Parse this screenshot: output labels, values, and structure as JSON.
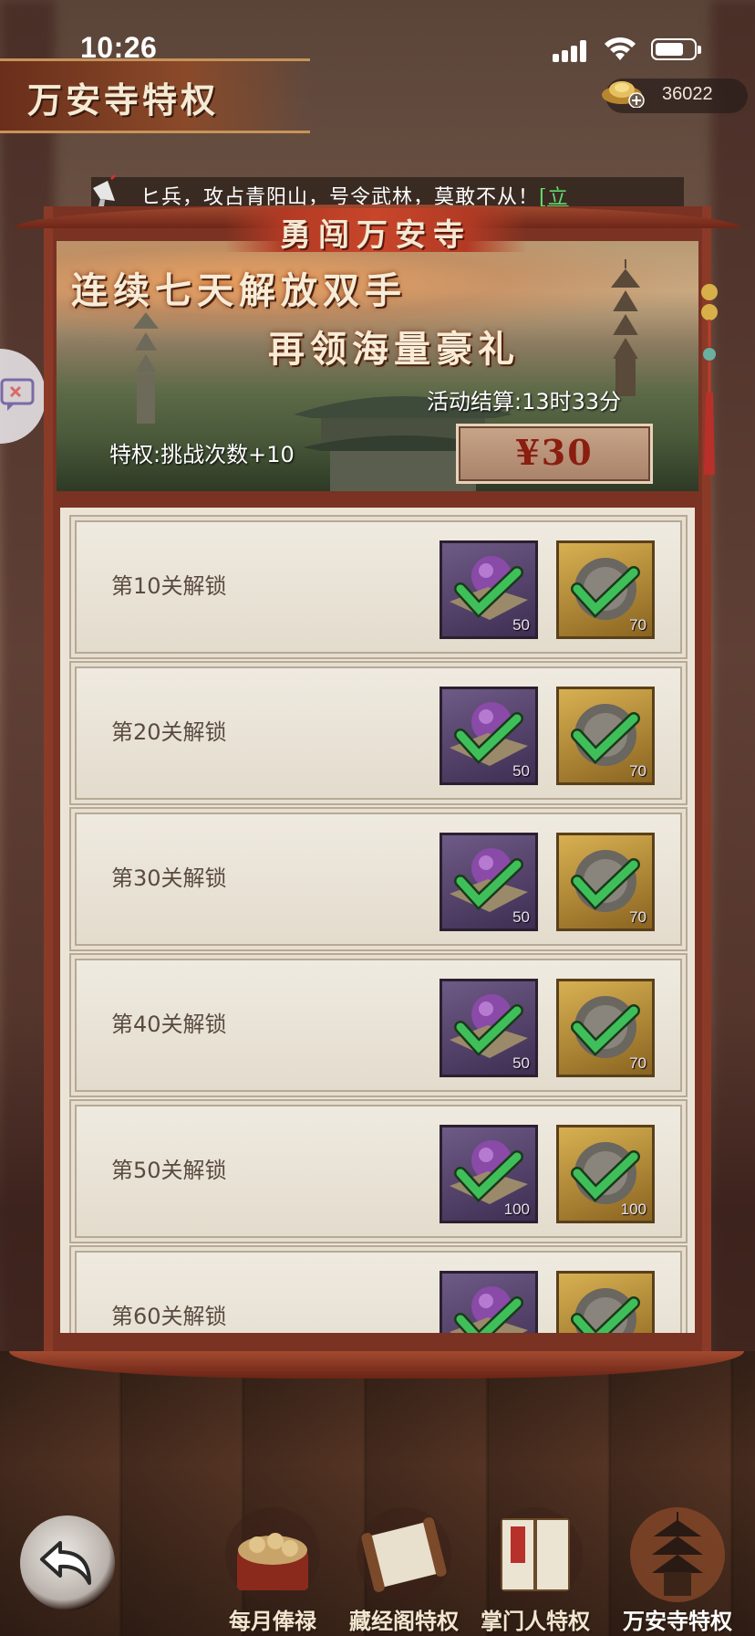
{
  "status_bar": {
    "time": "10:26"
  },
  "header": {
    "title": "万安寺特权",
    "currency_value": "36022"
  },
  "marquee": {
    "text": "ヒ兵，攻占青阳山，号令武林，莫敢不从！",
    "link": "[立"
  },
  "panel": {
    "ribbon": "勇闯万安寺",
    "promo_line1": "连续七天解放双手",
    "promo_line2": "再领海量豪礼",
    "timer": "活动结算:13时33分",
    "privilege": "特权:挑战次数+10",
    "price": "¥30"
  },
  "rewards": [
    {
      "label": "第10关解锁",
      "purple_count": "50",
      "gold_count": "70"
    },
    {
      "label": "第20关解锁",
      "purple_count": "50",
      "gold_count": "70"
    },
    {
      "label": "第30关解锁",
      "purple_count": "50",
      "gold_count": "70"
    },
    {
      "label": "第40关解锁",
      "purple_count": "50",
      "gold_count": "70"
    },
    {
      "label": "第50关解锁",
      "purple_count": "100",
      "gold_count": "100"
    },
    {
      "label": "第60关解锁",
      "purple_count": "",
      "gold_count": ""
    }
  ],
  "nav": {
    "tabs": [
      {
        "label": "每月俸禄",
        "icon": "treasure-chest-icon"
      },
      {
        "label": "藏经阁特权",
        "icon": "scroll-icon"
      },
      {
        "label": "掌门人特权",
        "icon": "book-icon"
      },
      {
        "label": "万安寺特权",
        "icon": "pagoda-icon"
      }
    ],
    "active": "万安寺特权"
  },
  "colors": {
    "panel_red": "#8b3a28",
    "check_green": "#3fbf5a",
    "price_red": "#8a1e10"
  }
}
